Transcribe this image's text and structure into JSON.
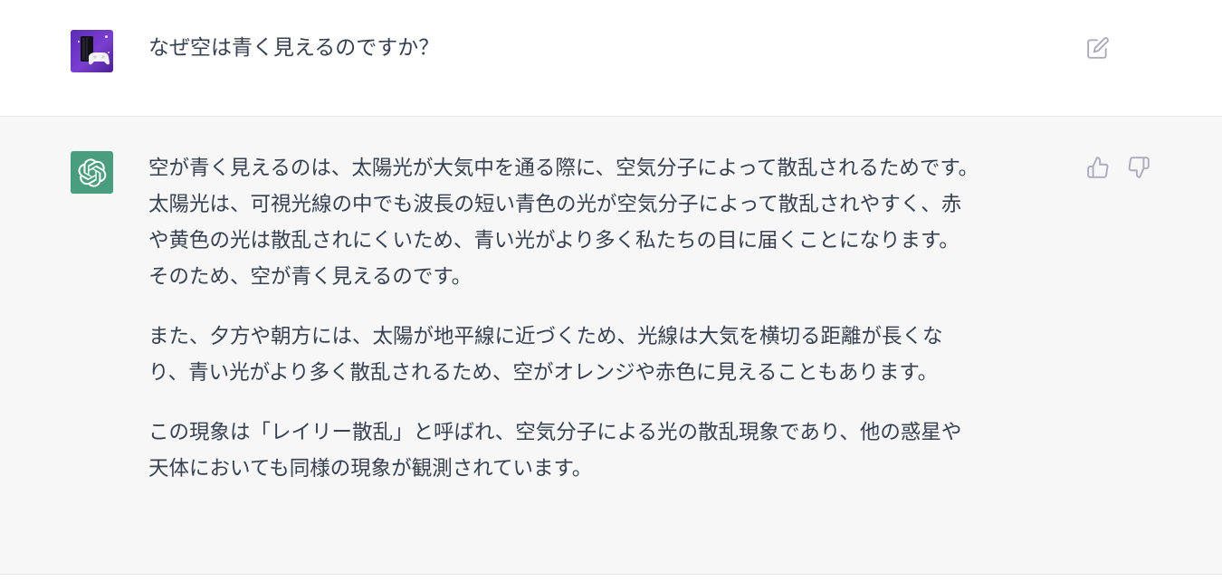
{
  "conversation": {
    "user_message": {
      "text": "なぜ空は青く見えるのですか？",
      "avatar_icon": "gamer-avatar-icon",
      "action_icon": "edit-icon"
    },
    "assistant_message": {
      "avatar_icon": "openai-logo-icon",
      "avatar_color": "#4a9d7f",
      "paragraphs": [
        {
          "lines": [
            "空が青く見えるのは、太陽光が大気中を通る際に、空気分子によって散乱されるためです。",
            "太陽光は、可視光線の中でも波長の短い青色の光が空気分子によって散乱されやすく、赤",
            "や黄色の光は散乱されにくいため、青い光がより多く私たちの目に届くことになります。",
            "そのため、空が青く見えるのです。"
          ]
        },
        {
          "lines": [
            "また、夕方や朝方には、太陽が地平線に近づくため、光線は大気を横切る距離が長くな",
            "り、青い光がより多く散乱されるため、空がオレンジや赤色に見えることもあります。"
          ]
        },
        {
          "lines": [
            "この現象は「レイリー散乱」と呼ばれ、空気分子による光の散乱現象であり、他の惑星や",
            "天体においても同様の現象が観測されています。"
          ]
        }
      ],
      "feedback_icons": [
        "thumbs-up-icon",
        "thumbs-down-icon"
      ]
    }
  },
  "colors": {
    "user_row_bg": "#ffffff",
    "assistant_row_bg": "#f7f7f8",
    "text": "#374151",
    "icon": "#acacbe"
  }
}
